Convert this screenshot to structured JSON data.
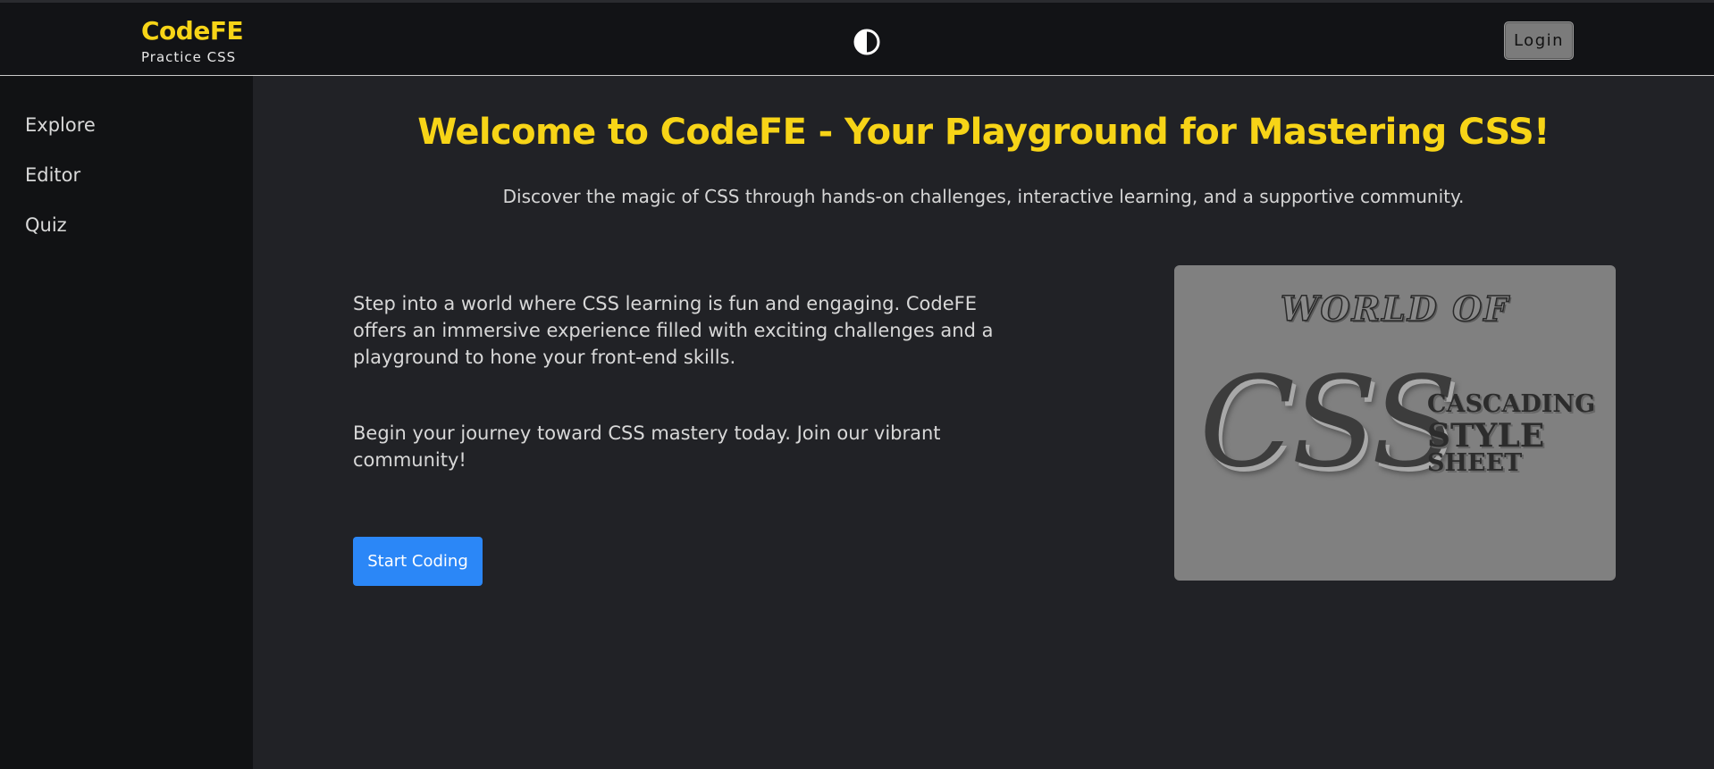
{
  "header": {
    "brand_name": "CodeFE",
    "brand_subtitle": "Practice CSS",
    "theme_toggle_icon": "contrast-icon",
    "login_label": "Login"
  },
  "sidebar": {
    "items": [
      {
        "label": "Explore"
      },
      {
        "label": "Editor"
      },
      {
        "label": "Quiz"
      }
    ]
  },
  "main": {
    "headline": "Welcome to CodeFE - Your Playground for Mastering CSS!",
    "subheadline": "Discover the magic of CSS through hands-on challenges, interactive learning, and a supportive community.",
    "paragraph_1": "Step into a world where CSS learning is fun and engaging. CodeFE offers an immersive experience filled with exciting challenges and a playground to hone your front-end skills.",
    "paragraph_2": "Begin your journey toward CSS mastery today. Join our vibrant community!",
    "cta_label": "Start Coding",
    "hero_image": {
      "top_text": "WORLD OF",
      "main_text": "CSS",
      "line_1": "CASCADING",
      "line_2": "STYLE",
      "line_3": "SHEET"
    }
  },
  "colors": {
    "accent": "#f7d417",
    "primary_button": "#2b87f7",
    "background": "#212226",
    "sidebar": "#111214",
    "topbar": "#121316"
  }
}
